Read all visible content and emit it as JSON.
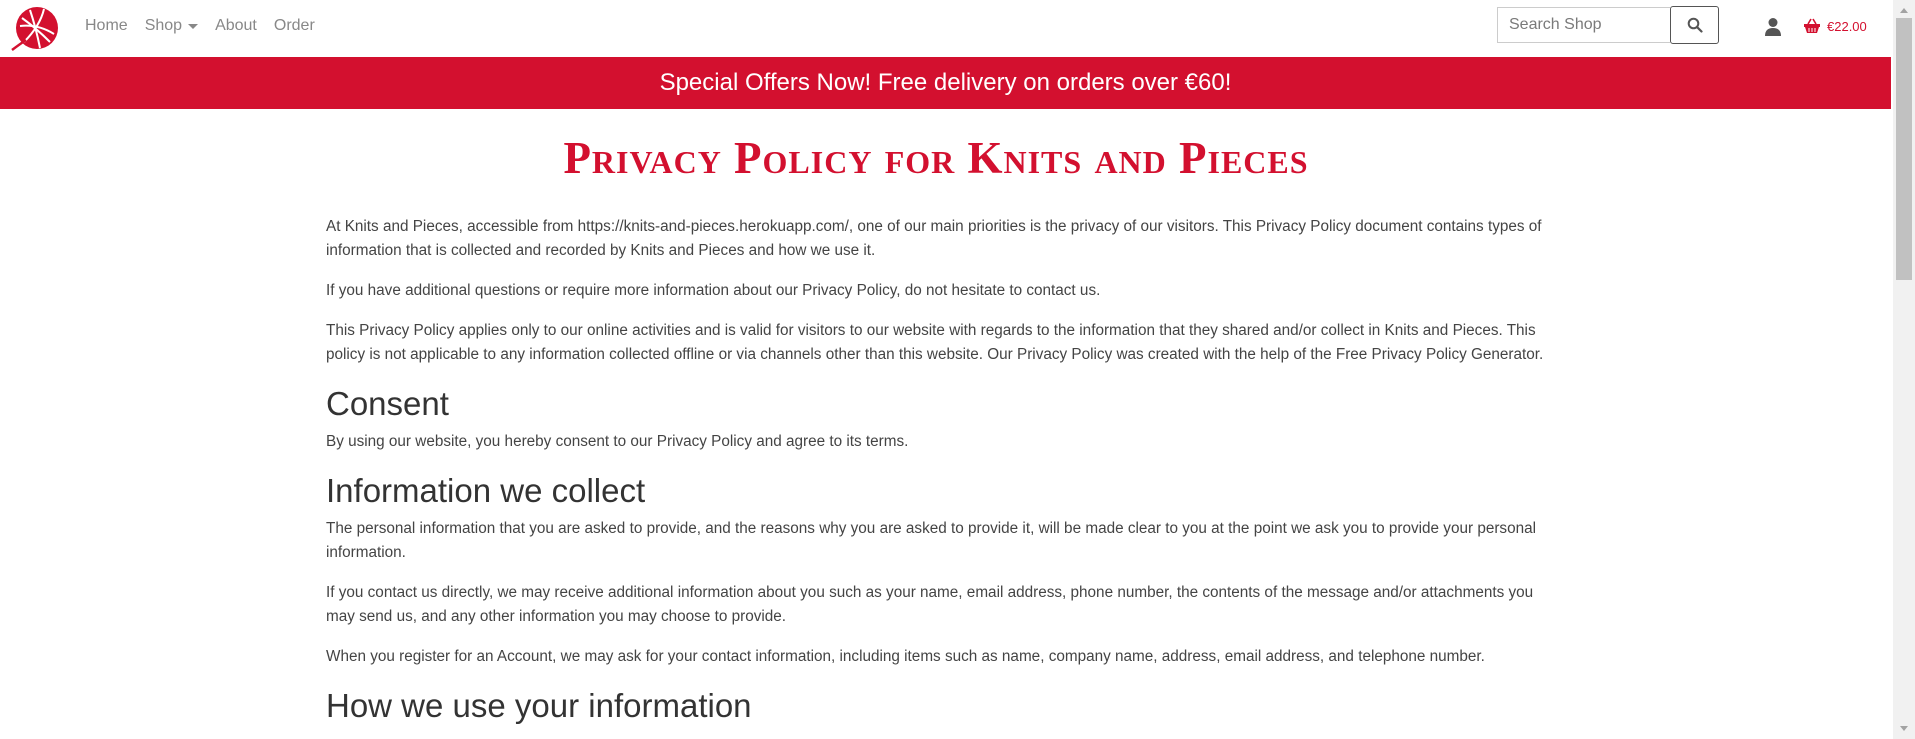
{
  "nav": {
    "logo_icon": "yarn-ball-logo-icon",
    "links": [
      "Home",
      "Shop",
      "About",
      "Order"
    ],
    "search_placeholder": "Search Shop",
    "search_icon": "search-icon",
    "account_icon": "user-icon",
    "cart_icon": "basket-icon",
    "cart_total": "€22.00"
  },
  "banner": {
    "text": "Special Offers Now! Free delivery on orders over €60!"
  },
  "page": {
    "title": "Privacy Policy for Knits and Pieces",
    "intro": [
      "At Knits and Pieces, accessible from https://knits-and-pieces.herokuapp.com/, one of our main priorities is the privacy of our visitors. This Privacy Policy document contains types of information that is collected and recorded by Knits and Pieces and how we use it.",
      "If you have additional questions or require more information about our Privacy Policy, do not hesitate to contact us.",
      "This Privacy Policy applies only to our online activities and is valid for visitors to our website with regards to the information that they shared and/or collect in Knits and Pieces. This policy is not applicable to any information collected offline or via channels other than this website. Our Privacy Policy was created with the help of the Free Privacy Policy Generator."
    ],
    "sections": [
      {
        "heading": "Consent",
        "paragraphs": [
          "By using our website, you hereby consent to our Privacy Policy and agree to its terms."
        ]
      },
      {
        "heading": "Information we collect",
        "paragraphs": [
          "The personal information that you are asked to provide, and the reasons why you are asked to provide it, will be made clear to you at the point we ask you to provide your personal information.",
          "If you contact us directly, we may receive additional information about you such as your name, email address, phone number, the contents of the message and/or attachments you may send us, and any other information you may choose to provide.",
          "When you register for an Account, we may ask for your contact information, including items such as name, company name, address, email address, and telephone number."
        ]
      },
      {
        "heading": "How we use your information",
        "paragraphs": []
      }
    ]
  },
  "colors": {
    "brand": "#d3102f",
    "nav_text": "#888888",
    "body_text": "#444444"
  }
}
